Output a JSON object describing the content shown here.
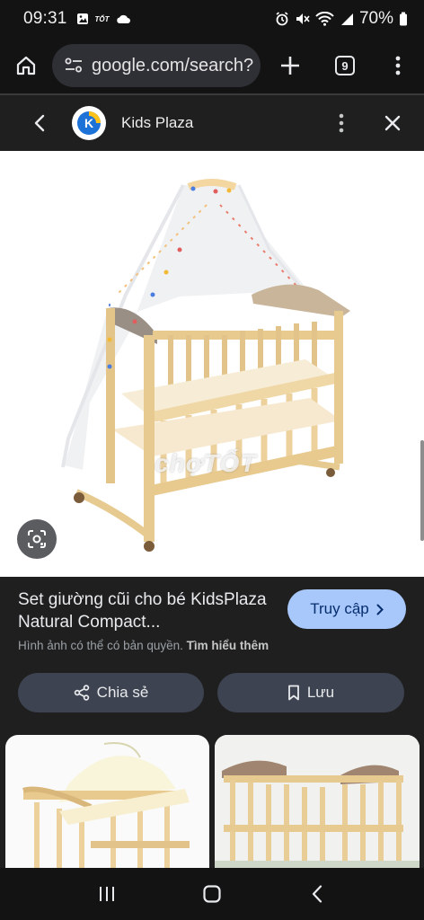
{
  "status_bar": {
    "time": "09:31",
    "app_label": "TỐT",
    "battery_pct": "70%"
  },
  "toolbar": {
    "url": "google.com/search?",
    "tab_count": "9"
  },
  "source": {
    "name": "Kids Plaza",
    "logo_letter": "K"
  },
  "image": {
    "watermark": "chợTỐT"
  },
  "result": {
    "title": "Set giường cũi cho bé KidsPlaza Natural Compact...",
    "visit_label": "Truy cập",
    "copyright_text": "Hình ảnh có thể có bản quyền.",
    "learn_more": "Tìm hiểu thêm",
    "share_label": "Chia sẻ",
    "save_label": "Lưu"
  },
  "colors": {
    "background": "#1f1f1f",
    "visit_button": "#a8c7fa",
    "action_button": "#3d4350",
    "wood": "#e9d3a4"
  },
  "icons": {
    "home": "home-icon",
    "tune": "tune-icon",
    "plus": "plus-icon",
    "more": "more-vert-icon",
    "back": "chevron-left-icon",
    "close": "close-icon",
    "lens": "lens-icon",
    "share": "share-icon",
    "bookmark": "bookmark-icon",
    "nav_recents": "recents-icon",
    "nav_home": "nav-home-icon",
    "nav_back": "nav-back-icon"
  }
}
